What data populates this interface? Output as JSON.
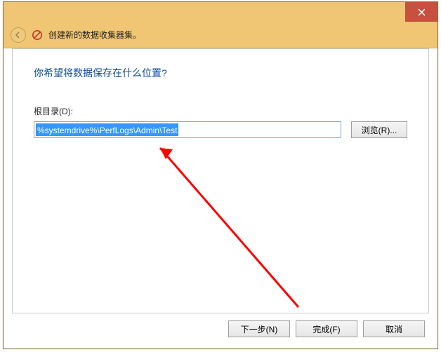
{
  "titlebar": {
    "close_tooltip": "Close"
  },
  "header": {
    "title": "创建新的数据收集器集。"
  },
  "content": {
    "question": "你希望将数据保存在什么位置?",
    "root_dir_label": "根目录(D):",
    "path_value": "%systemdrive%\\PerfLogs\\Admin\\Test",
    "browse_label": "浏览(R)..."
  },
  "footer": {
    "next_label": "下一步(N)",
    "finish_label": "完成(F)",
    "cancel_label": "取消"
  }
}
